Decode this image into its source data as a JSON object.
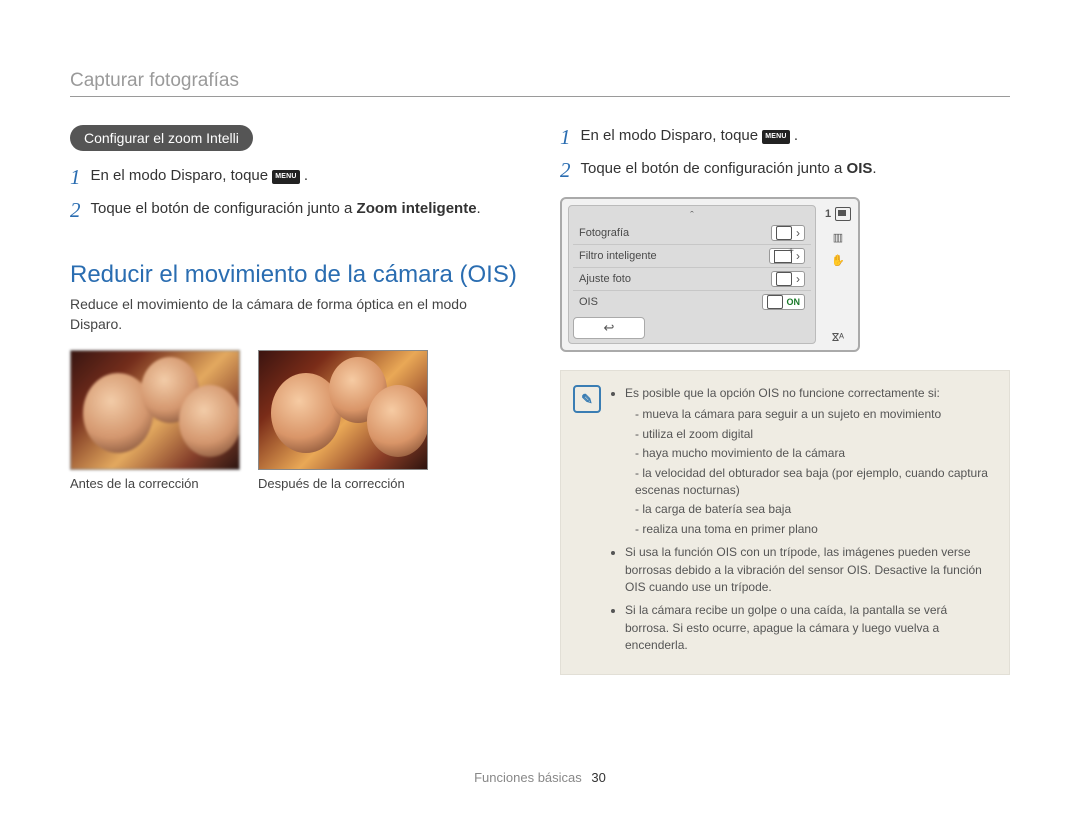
{
  "header": "Capturar fotografías",
  "iconPill": "Configurar el zoom Intelli",
  "menuChip": "MENU",
  "left": {
    "step1_a": "En el modo Disparo, toque ",
    "step1_b": " .",
    "step2_a": "Toque el botón de configuración junto a ",
    "step2_bold": "Zoom inteligente",
    "step2_c": ".",
    "sectionTitle": "Reducir el movimiento de la cámara (OIS)",
    "sectionDesc": "Reduce el movimiento de la cámara de forma óptica en el modo Disparo.",
    "caption1": "Antes de la corrección",
    "caption2": "Después de la corrección"
  },
  "right": {
    "step1_a": "En el modo Disparo, toque ",
    "step1_b": " .",
    "step2_a": "Toque el botón de configuración junto a ",
    "step2_bold": "OIS",
    "step2_c": "."
  },
  "lcd": {
    "count": "1",
    "rows": {
      "r1": "Fotografía",
      "r2": "Filtro inteligente",
      "r3": "Ajuste foto",
      "r4": "OIS"
    },
    "onLabel": "ON",
    "backArrow": "↩",
    "upCaret": "ˆ",
    "sideFlash": "ⴵᴬ"
  },
  "note": {
    "head": "Es posible que la opción OIS no funcione correctamente si:",
    "b1": "mueva la cámara para seguir a un sujeto en movimiento",
    "b2": "utiliza el zoom digital",
    "b3": "haya mucho movimiento de la cámara",
    "b4": "la velocidad del obturador sea baja (por ejemplo, cuando captura escenas nocturnas)",
    "b5": "la carga de batería sea baja",
    "b6": "realiza una toma en primer plano",
    "p2": "Si usa la función OIS con un trípode, las imágenes pueden verse borrosas debido a la vibración del sensor OIS. Desactive la función OIS cuando use un trípode.",
    "p3": "Si la cámara recibe un golpe o una caída, la pantalla se verá borrosa. Si esto ocurre, apague la cámara y luego vuelva a encenderla."
  },
  "footer": {
    "section": "Funciones básicas",
    "page": "30"
  }
}
